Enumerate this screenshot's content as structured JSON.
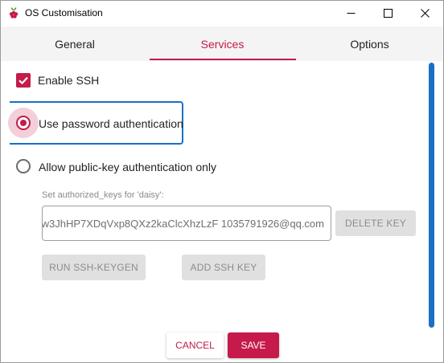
{
  "window": {
    "title": "OS Customisation",
    "icon": "raspberry-icon",
    "controls": [
      "minimize-icon",
      "maximize-icon",
      "close-icon"
    ]
  },
  "tabs": [
    {
      "label": "General",
      "active": false
    },
    {
      "label": "Services",
      "active": true
    },
    {
      "label": "Options",
      "active": false
    }
  ],
  "services": {
    "enable_ssh": {
      "label": "Enable SSH",
      "checked": true
    },
    "auth_options": [
      {
        "label": "Use password authentication",
        "selected": true
      },
      {
        "label": "Allow public-key authentication only",
        "selected": false
      }
    ],
    "authorized_keys_label": "Set authorized_keys for 'daisy':",
    "authorized_keys_value": "'w3JhHP7XDqVxp8QXz2kaClcXhzLzF 1035791926@qq.com",
    "delete_key_label": "DELETE KEY",
    "run_keygen_label": "RUN SSH-KEYGEN",
    "add_key_label": "ADD SSH KEY"
  },
  "footer": {
    "cancel_label": "CANCEL",
    "save_label": "SAVE"
  },
  "colors": {
    "accent": "#c51a4a",
    "focus": "#1a6fc4",
    "disabled_bg": "#e0e0e0"
  }
}
